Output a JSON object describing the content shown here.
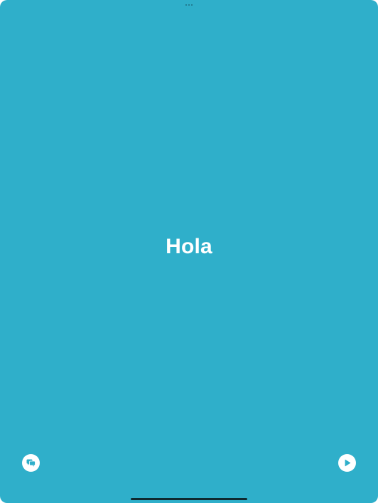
{
  "app": {
    "background_color": "#2fafca",
    "foreground_color": "#ffffff"
  },
  "top_handle": {
    "icon": "more-dots-icon"
  },
  "card": {
    "text": "Hola"
  },
  "bottom_bar": {
    "left_button": {
      "icon": "chat-bubbles-icon"
    },
    "right_button": {
      "icon": "play-icon"
    }
  },
  "home_indicator": {
    "color": "#0e2a30"
  }
}
